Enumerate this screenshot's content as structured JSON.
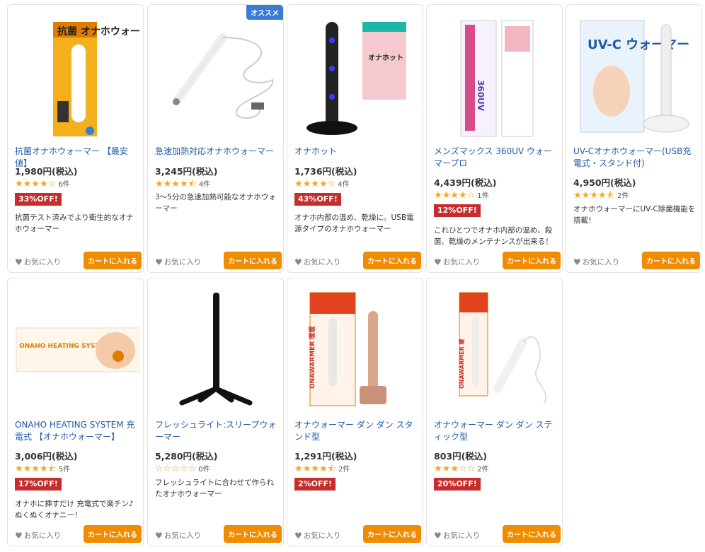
{
  "products": [
    {
      "title": "抗菌オナホウォーマー 【最安値】",
      "price": "1,980円(税込)",
      "rating": 4,
      "reviews": "6件",
      "discount": "33%OFF!",
      "desc": "抗菌テスト済みでより衛生的なオナホウォーマー",
      "favorite": "お気に入り",
      "cart": "カートに入れる",
      "badge": "",
      "box_text": "抗菌 オナホウォーマー"
    },
    {
      "title": "急速加熱対応オナホウォーマー",
      "price": "3,245円(税込)",
      "rating": 4.5,
      "reviews": "4件",
      "discount": "",
      "desc": "3〜5分の急速加熱可能なオナホウォーマー",
      "favorite": "お気に入り",
      "cart": "カートに入れる",
      "badge": "オススメ"
    },
    {
      "title": "オナホット",
      "price": "1,736円(税込)",
      "rating": 4,
      "reviews": "4件",
      "discount": "43%OFF!",
      "desc": "オナホ内部の温め、乾燥に。USB電源タイプのオナホウォーマー",
      "favorite": "お気に入り",
      "cart": "カートに入れる",
      "badge": "",
      "box_text": "オナホット"
    },
    {
      "title": "メンズマックス 360UV ウォーマープロ",
      "price": "4,439円(税込)",
      "rating": 4,
      "reviews": "1件",
      "discount": "12%OFF!",
      "desc": "これひとつでオナホ内部の温め、殺菌、乾燥のメンテナンスが出来る！",
      "favorite": "お気に入り",
      "cart": "カートに入れる",
      "badge": "",
      "box_text": "360UV"
    },
    {
      "title": "UV-Cオナホウォーマー(USB充電式・スタンド付)",
      "price": "4,950円(税込)",
      "rating": 4.5,
      "reviews": "2件",
      "discount": "",
      "desc": "オナホウォーマーにUV-C除菌機能を搭載！",
      "favorite": "お気に入り",
      "cart": "カートに入れる",
      "badge": "",
      "box_text": "UV-C ウォーマー"
    },
    {
      "title": "ONAHO HEATING SYSTEM 充電式 【オナホウォーマー】",
      "price": "3,006円(税込)",
      "rating": 4.5,
      "reviews": "5件",
      "discount": "17%OFF!",
      "desc": "オナホに挿すだけ 充電式で楽チン♪ ぬくぬくオナニー！",
      "favorite": "お気に入り",
      "cart": "カートに入れる",
      "badge": "",
      "box_text": "ONAHO HEATING SYSTEM"
    },
    {
      "title": "フレッシュライト:スリープウォーマー",
      "price": "5,280円(税込)",
      "rating": 0,
      "reviews": "0件",
      "discount": "",
      "desc": "フレッシュライトに合わせて作られたオナホウォーマー",
      "favorite": "お気に入り",
      "cart": "カートに入れる",
      "badge": ""
    },
    {
      "title": "オナウォーマー ダン ダン スタンド型",
      "price": "1,291円(税込)",
      "rating": 4.5,
      "reviews": "2件",
      "discount": "2%OFF!",
      "desc": "",
      "favorite": "お気に入り",
      "cart": "カートに入れる",
      "badge": "",
      "box_text": "ONAWARMER 暖暖"
    },
    {
      "title": "オナウォーマー ダン ダン スティック型",
      "price": "803円(税込)",
      "rating": 3,
      "reviews": "2件",
      "discount": "20%OFF!",
      "desc": "",
      "favorite": "お気に入り",
      "cart": "カートに入れる",
      "badge": "",
      "box_text": "ONAWARMER 暖"
    }
  ],
  "colors": {
    "title": "#1f5aa8",
    "discount": "#c62d2d",
    "cart": "#f08c00",
    "star": "#f5a623",
    "badge": "#3a7bd5"
  }
}
